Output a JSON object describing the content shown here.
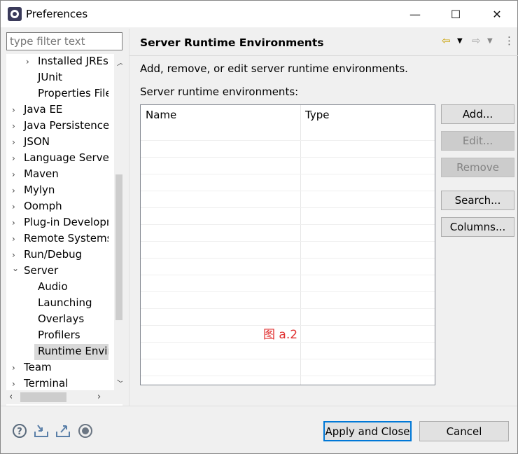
{
  "window": {
    "title": "Preferences",
    "minimize": "—",
    "maximize": "☐",
    "close": "✕"
  },
  "filter": {
    "placeholder": "type filter text",
    "value": ""
  },
  "tree": {
    "items": [
      {
        "label": "Installed JREs",
        "expander": "›"
      },
      {
        "label": "JUnit",
        "expander": ""
      },
      {
        "label": "Properties Files",
        "expander": ""
      },
      {
        "label": "Java EE",
        "expander": "›"
      },
      {
        "label": "Java Persistence",
        "expander": "›"
      },
      {
        "label": "JSON",
        "expander": "›"
      },
      {
        "label": "Language Servers",
        "expander": "›"
      },
      {
        "label": "Maven",
        "expander": "›"
      },
      {
        "label": "Mylyn",
        "expander": "›"
      },
      {
        "label": "Oomph",
        "expander": "›"
      },
      {
        "label": "Plug-in Development",
        "expander": "›"
      },
      {
        "label": "Remote Systems",
        "expander": "›"
      },
      {
        "label": "Run/Debug",
        "expander": "›"
      },
      {
        "label": "Server",
        "expander": "⌄"
      },
      {
        "label": "Audio",
        "expander": ""
      },
      {
        "label": "Launching",
        "expander": ""
      },
      {
        "label": "Overlays",
        "expander": ""
      },
      {
        "label": "Profilers",
        "expander": ""
      },
      {
        "label": "Runtime Environments",
        "expander": ""
      },
      {
        "label": "Team",
        "expander": "›"
      },
      {
        "label": "Terminal",
        "expander": "›"
      }
    ]
  },
  "page": {
    "title": "Server Runtime Environments",
    "description": "Add, remove, or edit server runtime environments.",
    "list_label": "Server runtime environments:",
    "columns": [
      "Name",
      "Type"
    ],
    "watermark": "图 a.2"
  },
  "buttons": {
    "add": "Add...",
    "edit": "Edit...",
    "remove": "Remove",
    "search": "Search...",
    "columns": "Columns...",
    "apply_close": "Apply and Close",
    "cancel": "Cancel"
  },
  "colors": {
    "accent": "#0078d7",
    "watermark": "#e03030"
  }
}
